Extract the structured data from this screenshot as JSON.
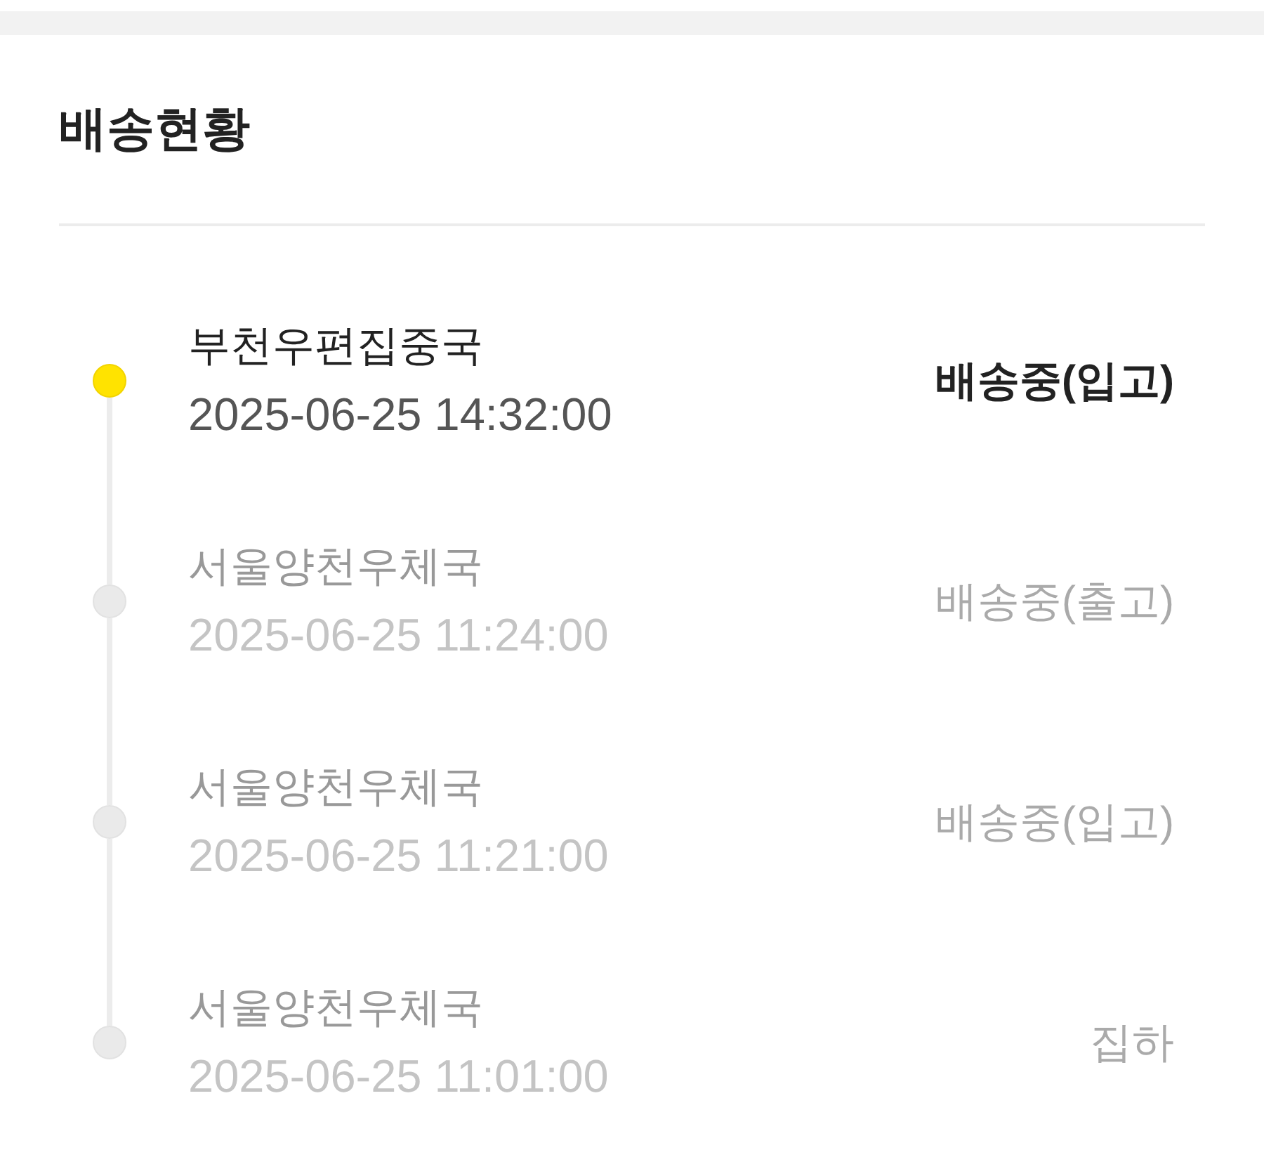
{
  "title": "배송현황",
  "events": [
    {
      "location": "부천우편집중국",
      "time": "2025-06-25 14:32:00",
      "status": "배송중(입고)",
      "current": true
    },
    {
      "location": "서울양천우체국",
      "time": "2025-06-25 11:24:00",
      "status": "배송중(출고)",
      "current": false
    },
    {
      "location": "서울양천우체국",
      "time": "2025-06-25 11:21:00",
      "status": "배송중(입고)",
      "current": false
    },
    {
      "location": "서울양천우체국",
      "time": "2025-06-25 11:01:00",
      "status": "집하",
      "current": false
    }
  ]
}
